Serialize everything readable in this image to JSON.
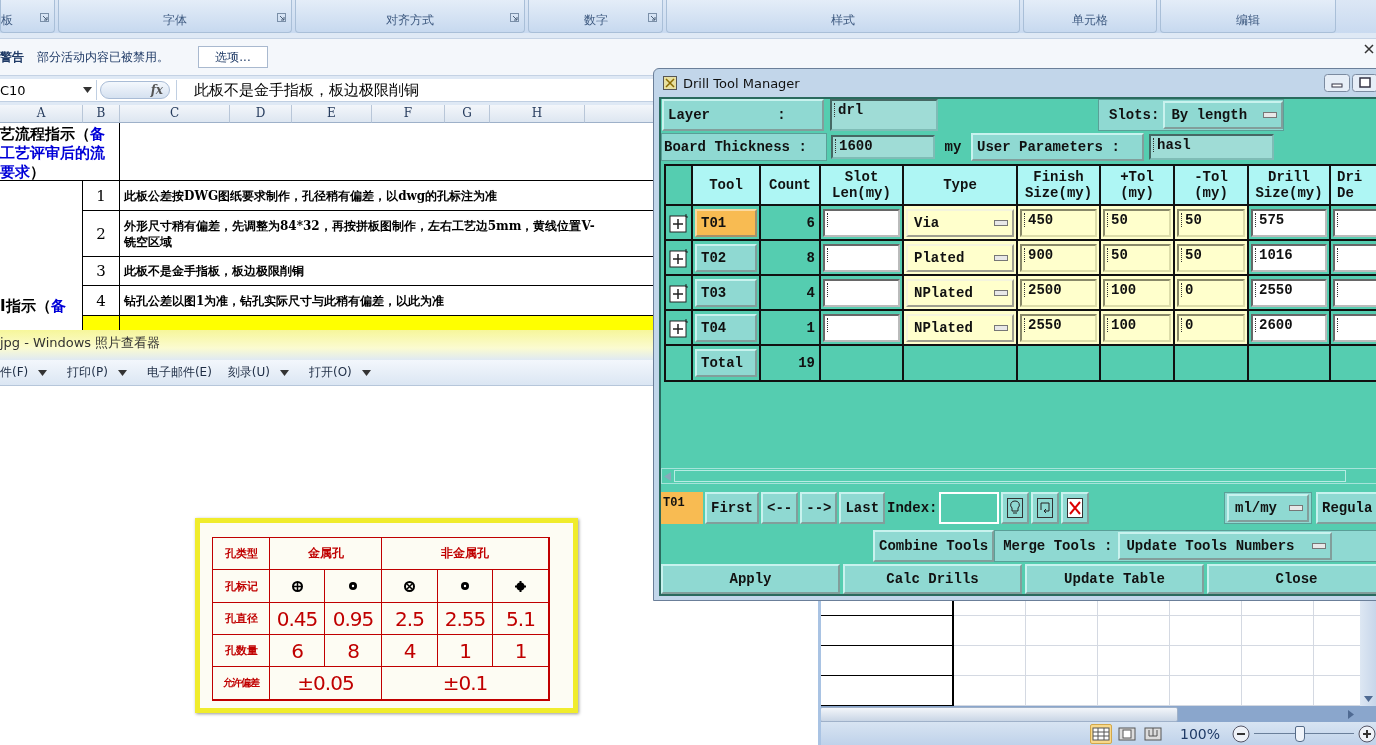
{
  "excel": {
    "ribbon_groups": [
      {
        "label": "板",
        "launcher": true
      },
      {
        "label": "字体",
        "launcher": true
      },
      {
        "label": "对齐方式",
        "launcher": true
      },
      {
        "label": "数字",
        "launcher": true
      },
      {
        "label": "样式",
        "launcher": false
      },
      {
        "label": "单元格",
        "launcher": false
      },
      {
        "label": "编辑",
        "launcher": false
      }
    ],
    "security_bar": {
      "title": "警告",
      "message": "部分活动内容已被禁用。",
      "button": "选项..."
    },
    "formula_bar": {
      "name_box": "C10",
      "function_label": "fx",
      "formula": "此板不是金手指板，板边极限削铜"
    },
    "columns": [
      "A",
      "B",
      "C",
      "D",
      "E",
      "F",
      "G",
      "H"
    ],
    "section": {
      "lines": [
        [
          {
            "text": "艺流程指示（",
            "emphasis": false
          },
          {
            "text": "备",
            "emphasis": true
          }
        ],
        [
          {
            "text": "工艺评审后的流",
            "emphasis": true
          }
        ],
        [
          {
            "text": "要求",
            "emphasis": true
          },
          {
            "text": "）",
            "emphasis": false
          }
        ]
      ]
    },
    "section_2": {
      "lines": [
        [
          {
            "text": "I指示（",
            "emphasis": false
          },
          {
            "text": "备",
            "emphasis": true
          }
        ]
      ]
    },
    "rows": [
      {
        "number": "1",
        "text": "此板公差按DWG图纸要求制作，孔径稍有偏差，以dwg的孔标注为准",
        "highlight": false
      },
      {
        "number": "2",
        "text": "外形尺寸稍有偏差，先调整为84*32，再按拼板图制作，左右工艺边5mm，黄线位置V-\n铣空区域",
        "highlight": false
      },
      {
        "number": "3",
        "text": "此板不是金手指板，板边极限削铜",
        "highlight": false
      },
      {
        "number": "4",
        "text": "钻孔公差以图1为准，钻孔实际尺寸与此稍有偏差，以此为准",
        "highlight": false
      },
      {
        "highlight": true
      }
    ],
    "status_bar": {
      "views": [
        {
          "selected": true
        },
        {
          "selected": false
        },
        {
          "selected": false
        }
      ],
      "zoom": "100%",
      "level": 0.45
    }
  },
  "viewer": {
    "title": "jpg - Windows 照片查看器",
    "menu": [
      {
        "label": "件(F)",
        "dropdown": true
      },
      {
        "label": "打印(P)",
        "dropdown": true
      },
      {
        "label": "电子邮件(E)",
        "dropdown": false
      },
      {
        "label": "刻录(U)",
        "dropdown": true
      },
      {
        "label": "打开(O)",
        "dropdown": true
      }
    ],
    "document": {
      "header": [
        "孔类型",
        "金属孔",
        "非金属孔"
      ],
      "mark_label": "孔标记",
      "marks": [
        {
          "kind": "cross"
        },
        {
          "kind": "dot"
        },
        {
          "kind": "x"
        },
        {
          "kind": "dot"
        },
        {
          "kind": "plus"
        }
      ],
      "diameter_label": "孔直径",
      "diameters": [
        "0.45",
        "0.95",
        "2.5",
        "2.55",
        "5.1"
      ],
      "count_label": "孔数量",
      "counts": [
        "6",
        "8",
        "4",
        "1",
        "1"
      ],
      "tolerance_label": "允许偏差",
      "tolerances": [
        "±0.05",
        "±0.1"
      ]
    }
  },
  "drill": {
    "title": "Drill Tool Manager",
    "layer_button": "Layer        :",
    "layer_value": "drl",
    "slots_label": "Slots:",
    "slots_value": "By length",
    "thickness_label": "Board Thickness :",
    "thickness_value": "1600",
    "thickness_unit": "my",
    "user_params_button": "User Parameters :",
    "user_params_value": "hasl",
    "columns": [
      "Tool",
      "Count",
      "Slot\nLen(my)",
      "Type",
      "Finish\nSize(my)",
      "+Tol\n(my)",
      "-Tol\n(my)",
      "Drill\nSize(my)",
      "Dri\nDe"
    ],
    "rows": [
      {
        "tool": "T01",
        "selected": true,
        "count": "6",
        "type": "Via",
        "finish": "450",
        "plus_tol": "50",
        "minus_tol": "50",
        "drill": "575"
      },
      {
        "tool": "T02",
        "selected": false,
        "count": "8",
        "type": "Plated",
        "finish": "900",
        "plus_tol": "50",
        "minus_tol": "50",
        "drill": "1016"
      },
      {
        "tool": "T03",
        "selected": false,
        "count": "4",
        "type": "NPlated",
        "finish": "2500",
        "plus_tol": "100",
        "minus_tol": "0",
        "drill": "2550"
      },
      {
        "tool": "T04",
        "selected": false,
        "count": "1",
        "type": "NPlated",
        "finish": "2550",
        "plus_tol": "100",
        "minus_tol": "0",
        "drill": "2600"
      }
    ],
    "total": {
      "label": "Total",
      "count": "19"
    },
    "nav": {
      "current": "T01",
      "buttons": [
        "First",
        "<--",
        "-->",
        "Last"
      ],
      "index_label": "Index:",
      "units": "ml/my",
      "cut_button": "Regula"
    },
    "merge": {
      "combine": "Combine Tools",
      "label": "Merge Tools :",
      "value": "Update Tools Numbers"
    },
    "actions": [
      "Apply",
      "Calc Drills",
      "Update Table",
      "Close"
    ]
  }
}
